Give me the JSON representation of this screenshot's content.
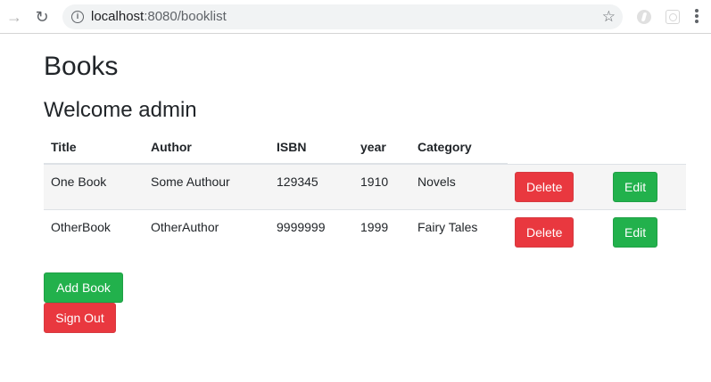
{
  "browser": {
    "url_host": "localhost",
    "url_rest": ":8080/booklist"
  },
  "page": {
    "title": "Books",
    "welcome": "Welcome admin"
  },
  "table": {
    "headers": [
      "Title",
      "Author",
      "ISBN",
      "year",
      "Category"
    ],
    "rows": [
      {
        "title": "One Book",
        "author": "Some Authour",
        "isbn": "129345",
        "year": "1910",
        "category": "Novels",
        "delete_label": "Delete",
        "edit_label": "Edit"
      },
      {
        "title": "OtherBook",
        "author": "OtherAuthor",
        "isbn": "9999999",
        "year": "1999",
        "category": "Fairy Tales",
        "delete_label": "Delete",
        "edit_label": "Edit"
      }
    ]
  },
  "actions": {
    "add_book_label": "Add Book",
    "sign_out_label": "Sign Out"
  },
  "colors": {
    "danger": "#e9383f",
    "success": "#22b14c"
  }
}
